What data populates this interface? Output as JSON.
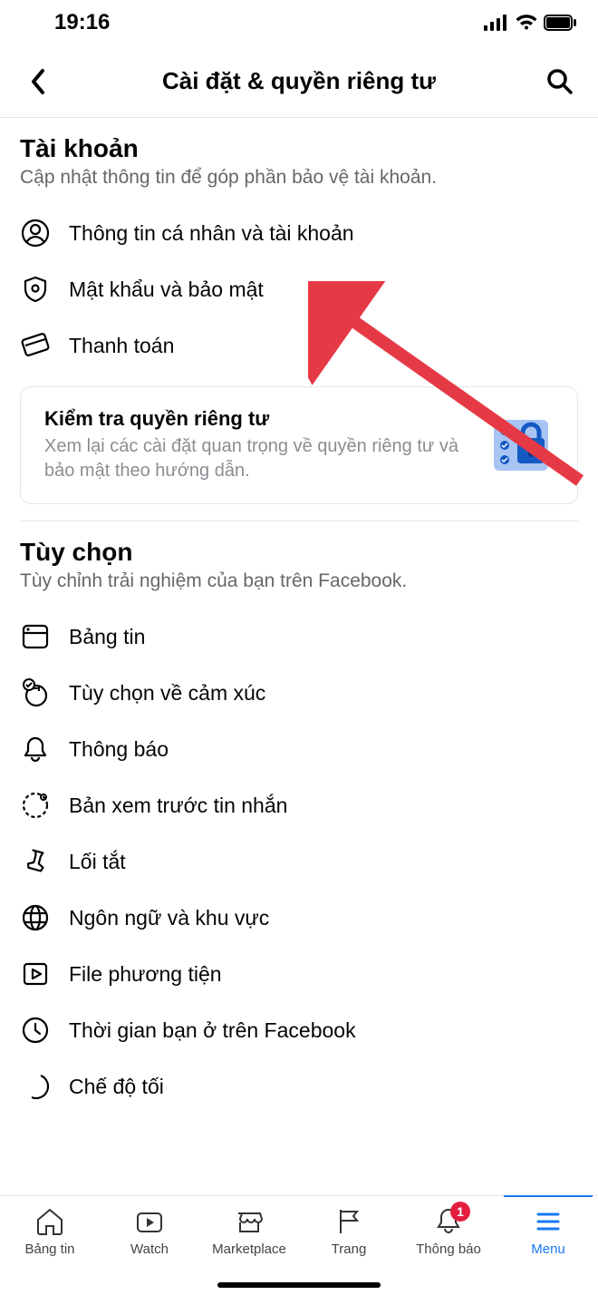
{
  "status": {
    "time": "19:16"
  },
  "header": {
    "title": "Cài đặt & quyền riêng tư"
  },
  "sections": [
    {
      "title": "Tài khoản",
      "desc": "Cập nhật thông tin để góp phần bảo vệ tài khoản.",
      "items": [
        {
          "label": "Thông tin cá nhân và tài khoản",
          "icon": "person-icon"
        },
        {
          "label": "Mật khẩu và bảo mật",
          "icon": "shield-icon"
        },
        {
          "label": "Thanh toán",
          "icon": "card-icon"
        }
      ],
      "card": {
        "title": "Kiểm tra quyền riêng tư",
        "sub": "Xem lại các cài đặt quan trọng về quyền riêng tư và bảo mật theo hướng dẫn."
      }
    },
    {
      "title": "Tùy chọn",
      "desc": "Tùy chỉnh trải nghiệm của bạn trên Facebook.",
      "items": [
        {
          "label": "Bảng tin",
          "icon": "feed-icon"
        },
        {
          "label": "Tùy chọn về cảm xúc",
          "icon": "reaction-icon"
        },
        {
          "label": "Thông báo",
          "icon": "bell-icon"
        },
        {
          "label": "Bản xem trước tin nhắn",
          "icon": "bubble-dashed-icon"
        },
        {
          "label": "Lối tắt",
          "icon": "pin-icon"
        },
        {
          "label": "Ngôn ngữ và khu vực",
          "icon": "globe-icon"
        },
        {
          "label": "File phương tiện",
          "icon": "media-icon"
        },
        {
          "label": "Thời gian bạn ở trên Facebook",
          "icon": "clock-icon"
        },
        {
          "label": "Chế độ tối",
          "icon": "moon-icon"
        }
      ]
    }
  ],
  "tabs": [
    {
      "label": "Bảng tin",
      "icon": "home-icon"
    },
    {
      "label": "Watch",
      "icon": "watch-icon"
    },
    {
      "label": "Marketplace",
      "icon": "market-icon"
    },
    {
      "label": "Trang",
      "icon": "flag-icon"
    },
    {
      "label": "Thông báo",
      "icon": "bell-icon",
      "badge": "1"
    },
    {
      "label": "Menu",
      "icon": "menu-icon",
      "active": true
    }
  ]
}
